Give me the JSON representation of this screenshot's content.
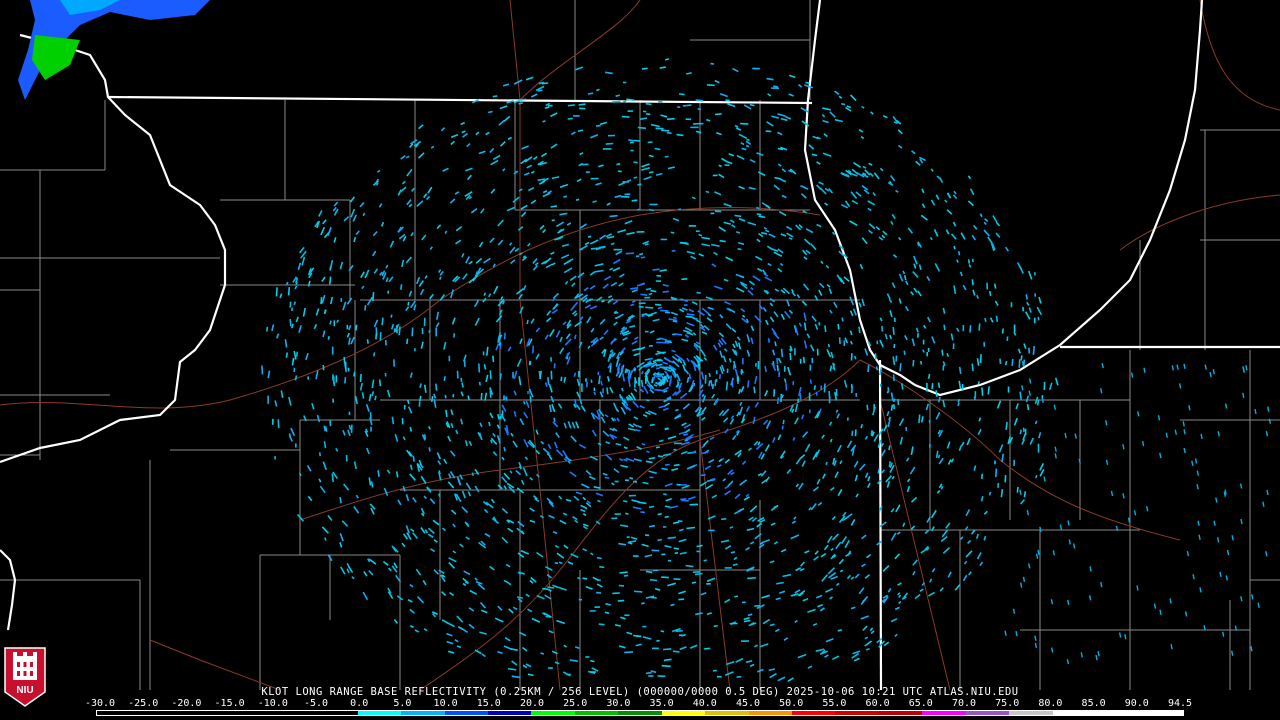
{
  "caption": "KLOT LONG RANGE BASE REFLECTIVITY (0.25KM / 256 LEVEL) (000000/0000 0.5 DEG) 2025-10-06 10:21 UTC  ATLAS.NIU.EDU",
  "logo": {
    "text": "NIU",
    "icon": "niu-castle-logo-icon",
    "color": "#c8102e"
  },
  "colorbar": {
    "tick_labels": [
      "-30.0",
      "-25.0",
      "-20.0",
      "-15.0",
      "-10.0",
      "-5.0",
      "0.0",
      "5.0",
      "10.0",
      "15.0",
      "20.0",
      "25.0",
      "30.0",
      "35.0",
      "40.0",
      "45.0",
      "50.0",
      "55.0",
      "60.0",
      "65.0",
      "70.0",
      "75.0",
      "80.0",
      "85.0",
      "90.0",
      "94.5"
    ],
    "colors": [
      "#000000",
      "#000000",
      "#000000",
      "#000000",
      "#000000",
      "#000000",
      "#00ffff",
      "#00b4ff",
      "#0050ff",
      "#0000c0",
      "#00ff00",
      "#00c000",
      "#009000",
      "#ffff00",
      "#e0c000",
      "#ff9000",
      "#ff0000",
      "#d00000",
      "#c00000",
      "#ff00ff",
      "#9955c9",
      "#c8c8c8",
      "#ffffff",
      "#ffffff",
      "#ffffff"
    ]
  },
  "map_colors": {
    "background": "#000000",
    "state_border": "#ffffff",
    "county_border": "#8a8a8a",
    "highway": "#8b3a2a",
    "echo_light": "#00d0e8",
    "echo_medium": "#1a7aff",
    "echo_strong": "#00e000"
  }
}
